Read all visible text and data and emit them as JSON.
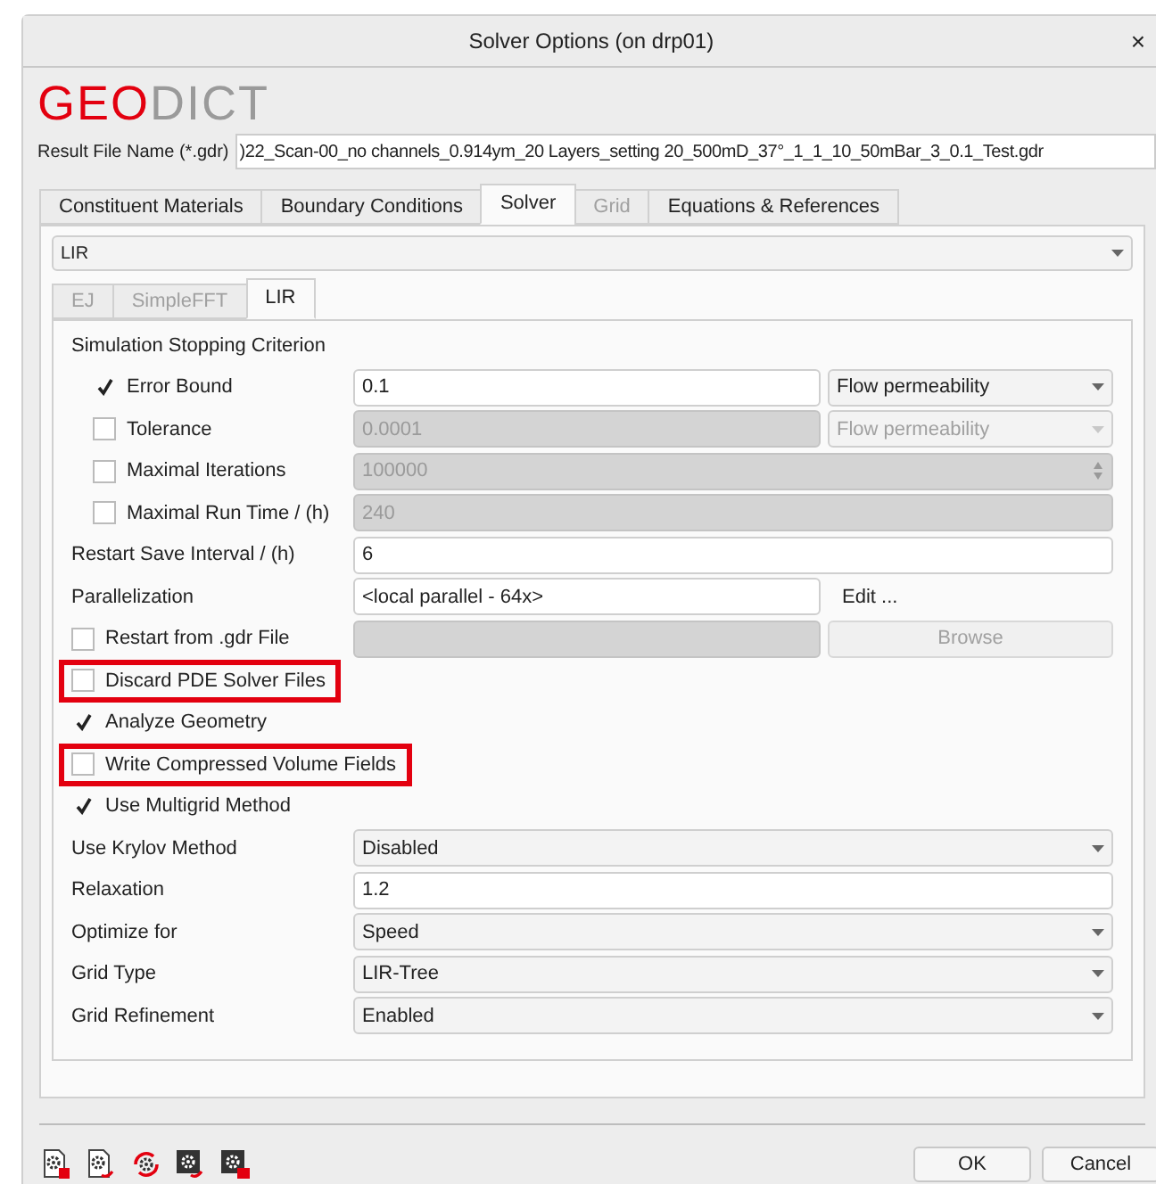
{
  "window": {
    "title": "Solver Options (on drp01)",
    "close": "×"
  },
  "logo": [
    "GEO",
    "DICT"
  ],
  "result_file": {
    "label": "Result File Name (*.gdr)",
    "value": ")22_Scan-00_no channels_0.914ym_20 Layers_setting 20_500mD_37°_1_1_10_50mBar_3_0.1_Test.gdr"
  },
  "tabs": [
    {
      "label": "Constituent Materials",
      "selected": false,
      "disabled": false
    },
    {
      "label": "Boundary Conditions",
      "selected": false,
      "disabled": false
    },
    {
      "label": "Solver",
      "selected": true,
      "disabled": false
    },
    {
      "label": "Grid",
      "selected": false,
      "disabled": true
    },
    {
      "label": "Equations & References",
      "selected": false,
      "disabled": false
    }
  ],
  "solver_select": {
    "value": "LIR"
  },
  "solver_tabs": [
    {
      "label": "EJ",
      "selected": false,
      "disabled": true
    },
    {
      "label": "SimpleFFT",
      "selected": false,
      "disabled": true
    },
    {
      "label": "LIR",
      "selected": true,
      "disabled": false
    }
  ],
  "rows": [
    {
      "kind": "heading",
      "label": "Simulation Stopping Criterion"
    },
    {
      "kind": "sub-check",
      "label": "Error Bound",
      "checked": true,
      "field": {
        "kind": "text",
        "value": "0.1",
        "disabled": false
      },
      "side": {
        "kind": "select",
        "label": "Flow permeability",
        "disabled": false
      }
    },
    {
      "kind": "sub-check",
      "label": "Tolerance",
      "checked": false,
      "field": {
        "kind": "text",
        "value": "0.0001",
        "disabled": true
      },
      "side": {
        "kind": "select",
        "label": "Flow permeability",
        "disabled": true
      }
    },
    {
      "kind": "sub-check",
      "label": "Maximal Iterations",
      "checked": false,
      "field": {
        "kind": "spin",
        "value": "100000",
        "disabled": true
      }
    },
    {
      "kind": "sub-check",
      "label": "Maximal Run Time / (h)",
      "checked": false,
      "field": {
        "kind": "text",
        "value": "240",
        "disabled": true
      }
    },
    {
      "kind": "label",
      "label": "Restart Save Interval / (h)",
      "field": {
        "kind": "text",
        "value": "6",
        "disabled": false
      }
    },
    {
      "kind": "label",
      "label": "Parallelization",
      "field": {
        "kind": "text",
        "value": "<local parallel - 64x>",
        "disabled": false
      },
      "side": {
        "kind": "link",
        "label": "Edit ...",
        "disabled": false
      }
    },
    {
      "kind": "check",
      "label": "Restart from .gdr File",
      "checked": false,
      "field": {
        "kind": "text",
        "disabled": true
      },
      "side": {
        "kind": "button",
        "label": "Browse",
        "disabled": true
      }
    },
    {
      "kind": "check",
      "label": "Discard PDE Solver Files",
      "checked": false,
      "highlighted": true
    },
    {
      "kind": "check",
      "label": "Analyze Geometry",
      "checked": true,
      "highlighted": false
    },
    {
      "kind": "check",
      "label": "Write Compressed Volume Fields",
      "checked": false,
      "highlighted": true
    },
    {
      "kind": "check",
      "label": "Use Multigrid Method",
      "checked": true,
      "highlighted": false
    },
    {
      "kind": "label",
      "label": "Use Krylov Method",
      "field": {
        "kind": "select",
        "value": "Disabled",
        "disabled": false
      }
    },
    {
      "kind": "label",
      "label": "Relaxation",
      "field": {
        "kind": "text",
        "value": "1.2",
        "disabled": false
      }
    },
    {
      "kind": "label",
      "label": "Optimize for",
      "field": {
        "kind": "select",
        "value": "Speed",
        "disabled": false
      }
    },
    {
      "kind": "label",
      "label": "Grid Type",
      "field": {
        "kind": "select",
        "value": "LIR-Tree",
        "disabled": false
      }
    },
    {
      "kind": "label",
      "label": "Grid Refinement",
      "field": {
        "kind": "select",
        "value": "Enabled",
        "disabled": false
      }
    }
  ],
  "buttons": [
    "OK",
    "Cancel"
  ]
}
